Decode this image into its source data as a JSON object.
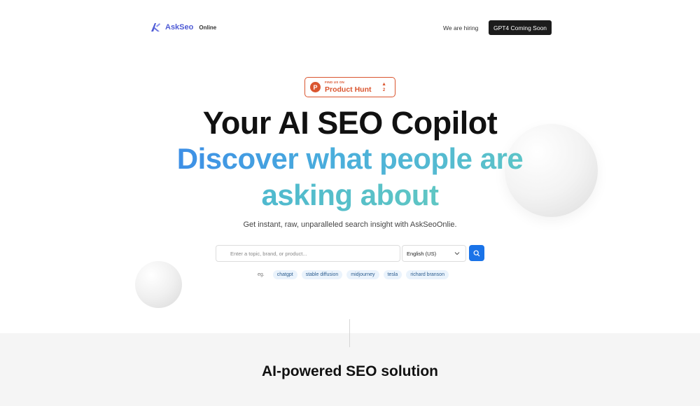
{
  "header": {
    "logo_icon": "askseo-logo-icon",
    "brand": "AskSeo",
    "brand_suffix": "Online",
    "hiring_link": "We are hiring",
    "cta_button": "GPT4 Coming Soon"
  },
  "product_hunt": {
    "small_text": "FIND US ON",
    "name": "Product Hunt",
    "logo_letter": "P",
    "upvote_icon": "triangle-up-icon",
    "votes": "2",
    "color": "#da552f"
  },
  "hero": {
    "title": "Your AI SEO Copilot",
    "subtitle_line1": "Discover what people are",
    "subtitle_line2": "asking about",
    "tagline": "Get instant, raw, unparalleled search insight with AskSeoOnlie."
  },
  "search": {
    "placeholder": "Enter a topic, brand, or product...",
    "value": "",
    "language": "English (US)",
    "button_icon": "search-icon",
    "button_color": "#1a73e8"
  },
  "examples": {
    "label": "eg.",
    "chips": [
      "chatgpt",
      "stable diffusion",
      "midjourney",
      "tesla",
      "richard branson"
    ]
  },
  "section": {
    "title": "AI-powered SEO solution"
  }
}
